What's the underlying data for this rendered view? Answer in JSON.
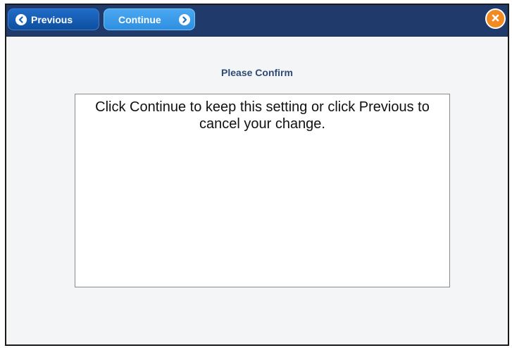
{
  "toolbar": {
    "previous_label": "Previous",
    "continue_label": "Continue",
    "previous_icon": "chevron-left-icon",
    "continue_icon": "chevron-right-icon",
    "close_icon": "close-icon"
  },
  "dialog": {
    "title": "Please Confirm",
    "message": "Click Continue to keep this setting or click Previous to cancel your change."
  },
  "colors": {
    "toolbar_bg": "#1f3a6b",
    "previous_button": "#1565c0",
    "continue_button": "#3d9be9",
    "close_button": "#f28a22",
    "title_text": "#2e4a75",
    "panel_bg": "#f4f5f7"
  }
}
